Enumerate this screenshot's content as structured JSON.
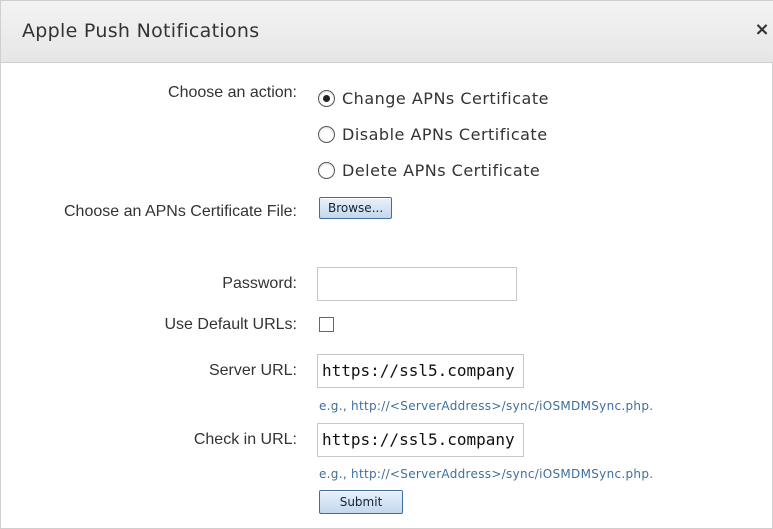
{
  "dialog": {
    "title": "Apple Push Notifications",
    "close_glyph": "×"
  },
  "form": {
    "action_label": "Choose an action:",
    "actions": [
      {
        "label": "Change APNs Certificate",
        "selected": true
      },
      {
        "label": "Disable APNs Certificate",
        "selected": false
      },
      {
        "label": "Delete APNs Certificate",
        "selected": false
      }
    ],
    "certificate_label": "Choose an APNs Certificate File:",
    "browse_label": "Browse...",
    "password_label": "Password:",
    "password_value": "",
    "default_urls_label": "Use Default URLs:",
    "default_urls_checked": false,
    "server_url_label": "Server URL:",
    "server_url_value": "https://ssl5.company",
    "server_url_hint": "e.g., http://<ServerAddress>/sync/iOSMDMSync.php.",
    "checkin_url_label": "Check in URL:",
    "checkin_url_value": "https://ssl5.company",
    "checkin_url_hint": "e.g., http://<ServerAddress>/sync/iOSMDMSync.php.",
    "submit_label": "Submit"
  }
}
